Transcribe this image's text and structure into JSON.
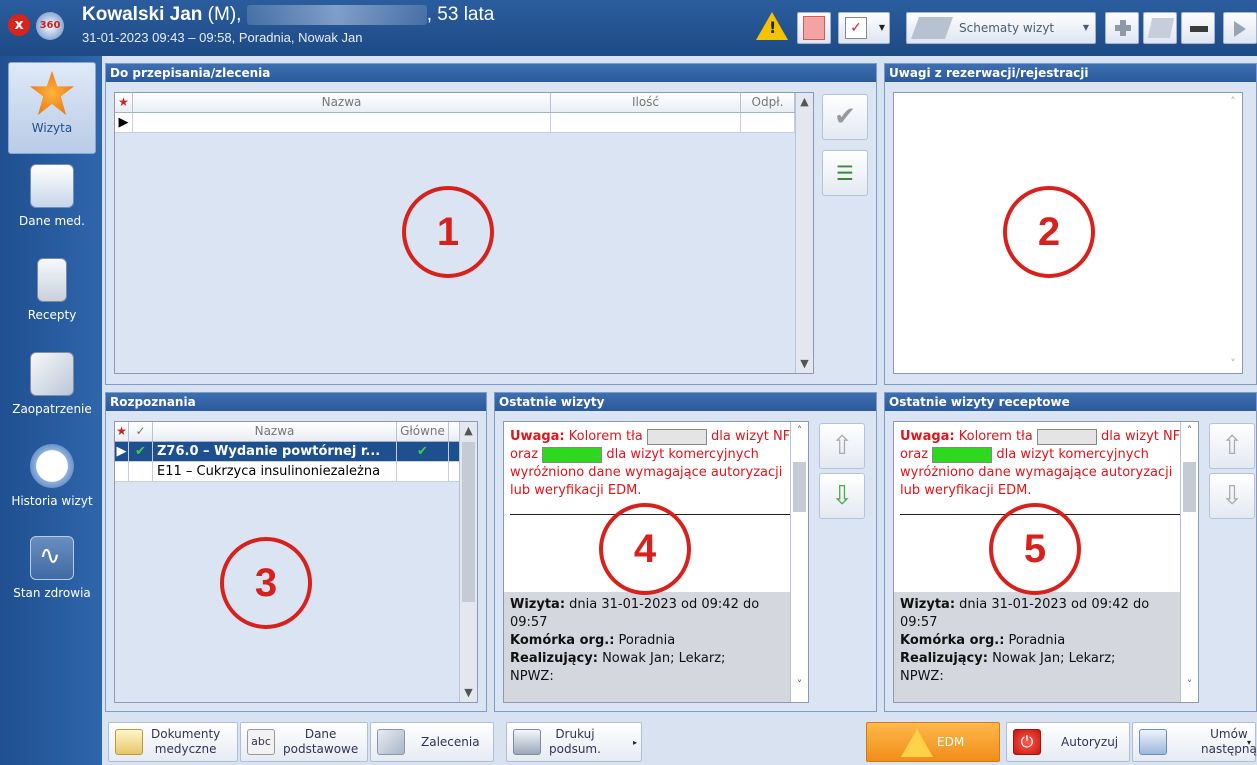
{
  "header": {
    "close_icon": "x",
    "avatar_text": "360",
    "patient_name": "Kowalski Jan",
    "patient_sex": " (M),",
    "patient_age": ", 53 lata",
    "visit_info": "31-01-2023 09:43 – 09:58, Poradnia, Nowak Jan",
    "schematy_label": "Schematy wizyt",
    "warn_glyph": "!"
  },
  "sidebar": {
    "items": [
      {
        "label": "Wizyta"
      },
      {
        "label": "Dane med."
      },
      {
        "label": "Recepty"
      },
      {
        "label": "Zaopatrzenie"
      },
      {
        "label": "Historia wizyt"
      },
      {
        "label": "Stan zdrowia"
      }
    ]
  },
  "panel1": {
    "title": "Do przepisania/zlecenia",
    "columns": [
      "Nazwa",
      "Ilość",
      "Odpł."
    ],
    "star": "★",
    "circle": "1"
  },
  "panel2": {
    "title": "Uwagi z rezerwacji/rejestracji",
    "circle": "2"
  },
  "panel3": {
    "title": "Rozpoznania",
    "columns": [
      "Nazwa",
      "Główne"
    ],
    "rows": [
      {
        "name": "Z76.0 – Wydanie powtórnej r...",
        "main": "✔",
        "check": "✔"
      },
      {
        "name": "E11 – Cukrzyca insulinoniezależna",
        "main": "",
        "check": ""
      }
    ],
    "circle": "3"
  },
  "panel4": {
    "title": "Ostatnie wizyty",
    "warn_bold": "Uwaga:",
    "warn_text1": " Kolorem tła ",
    "warn_text2": " dla wizyt NFZ oraz ",
    "warn_text3": " dla wizyt komercyjnych wyróżniono dane wymagające autoryzacji lub weryfikacji EDM.",
    "visit_label": "Wizyta:",
    "visit_value": " dnia 31-01-2023 od 09:42 do 09:57",
    "unit_label": "Komórka org.:",
    "unit_value": " Poradnia",
    "realizer_label": "Realizujący:",
    "realizer_value": " Nowak Jan; Lekarz;",
    "npwz_label": "NPWZ:",
    "circle": "4",
    "swatch_nfz": "#e4e4e4",
    "swatch_kom": "#2ed81e"
  },
  "panel5": {
    "title": "Ostatnie wizyty receptowe",
    "circle": "5"
  },
  "bottom": {
    "dokumenty": "Dokumenty\nmedyczne",
    "dane_podstawowe": "Dane\npodstawowe",
    "zalecenia": "Zalecenia",
    "drukuj": "Drukuj\npodsum.",
    "edm": "EDM",
    "autoryzuj": "Autoryzuj",
    "umow": "Umów\nnastępną",
    "abc": "abc"
  }
}
